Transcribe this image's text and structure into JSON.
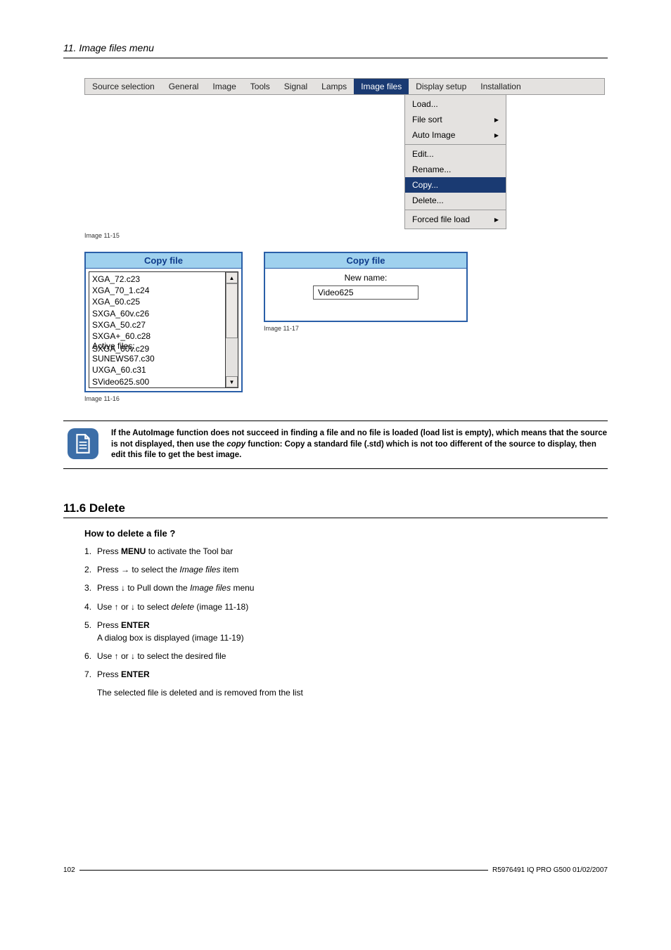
{
  "chapter": "11. Image files menu",
  "menubar": {
    "items": [
      "Source selection",
      "General",
      "Image",
      "Tools",
      "Signal",
      "Lamps",
      "Image files",
      "Display setup",
      "Installation"
    ],
    "active_index": 6
  },
  "dropdown": {
    "groups": [
      [
        {
          "label": "Load...",
          "arrow": false
        },
        {
          "label": "File sort",
          "arrow": true
        },
        {
          "label": "Auto Image",
          "arrow": true
        }
      ],
      [
        {
          "label": "Edit...",
          "arrow": false
        },
        {
          "label": "Rename...",
          "arrow": false
        },
        {
          "label": "Copy...",
          "arrow": false,
          "selected": true
        },
        {
          "label": "Delete...",
          "arrow": false
        }
      ],
      [
        {
          "label": "Forced file load",
          "arrow": true
        }
      ]
    ]
  },
  "caption1": "Image 11-15",
  "copyFileList": {
    "title": "Copy file",
    "items": [
      "XGA_72.c23",
      "XGA_70_1.c24",
      "XGA_60.c25",
      "SXGA_60v.c26",
      "SXGA_50.c27",
      "SXGA+_60.c28",
      "Active files:",
      "SXGA_60v.c29",
      "SUNEWS67.c30",
      "UXGA_60.c31",
      "SVideo625.s00"
    ]
  },
  "caption2": "Image 11-16",
  "newNameDialog": {
    "title": "Copy file",
    "label": "New name:",
    "value": "Video625"
  },
  "caption3": "Image 11-17",
  "note": {
    "p1": "If the AutoImage function does not succeed in finding a file and no file is loaded (load list is empty), which means that the source is not displayed, then use the ",
    "copy_word": "copy",
    "p2": " function: Copy a standard file (.std) which is not too different of the source to display, then edit this file to get the best image."
  },
  "section": {
    "number_title": "11.6  Delete",
    "sub": "How to delete a file ?",
    "steps": {
      "s1a": "Press ",
      "s1b": "MENU",
      "s1c": " to activate the Tool bar",
      "s2a": "Press → to select the ",
      "s2b": "Image files",
      "s2c": " item",
      "s3a": "Press ↓ to Pull down the ",
      "s3b": "Image files",
      "s3c": " menu",
      "s4a": "Use ↑ or ↓ to select ",
      "s4b": "delete",
      "s4c": " (image 11-18)",
      "s5a": "Press ",
      "s5b": "ENTER",
      "s5note": "A dialog box is displayed (image 11-19)",
      "s6": "Use ↑ or ↓ to select the desired file",
      "s7a": "Press ",
      "s7b": "ENTER",
      "s7note": "The selected file is deleted and is removed from the list"
    }
  },
  "footer": {
    "page": "102",
    "doc": "R5976491 IQ PRO G500 01/02/2007"
  }
}
